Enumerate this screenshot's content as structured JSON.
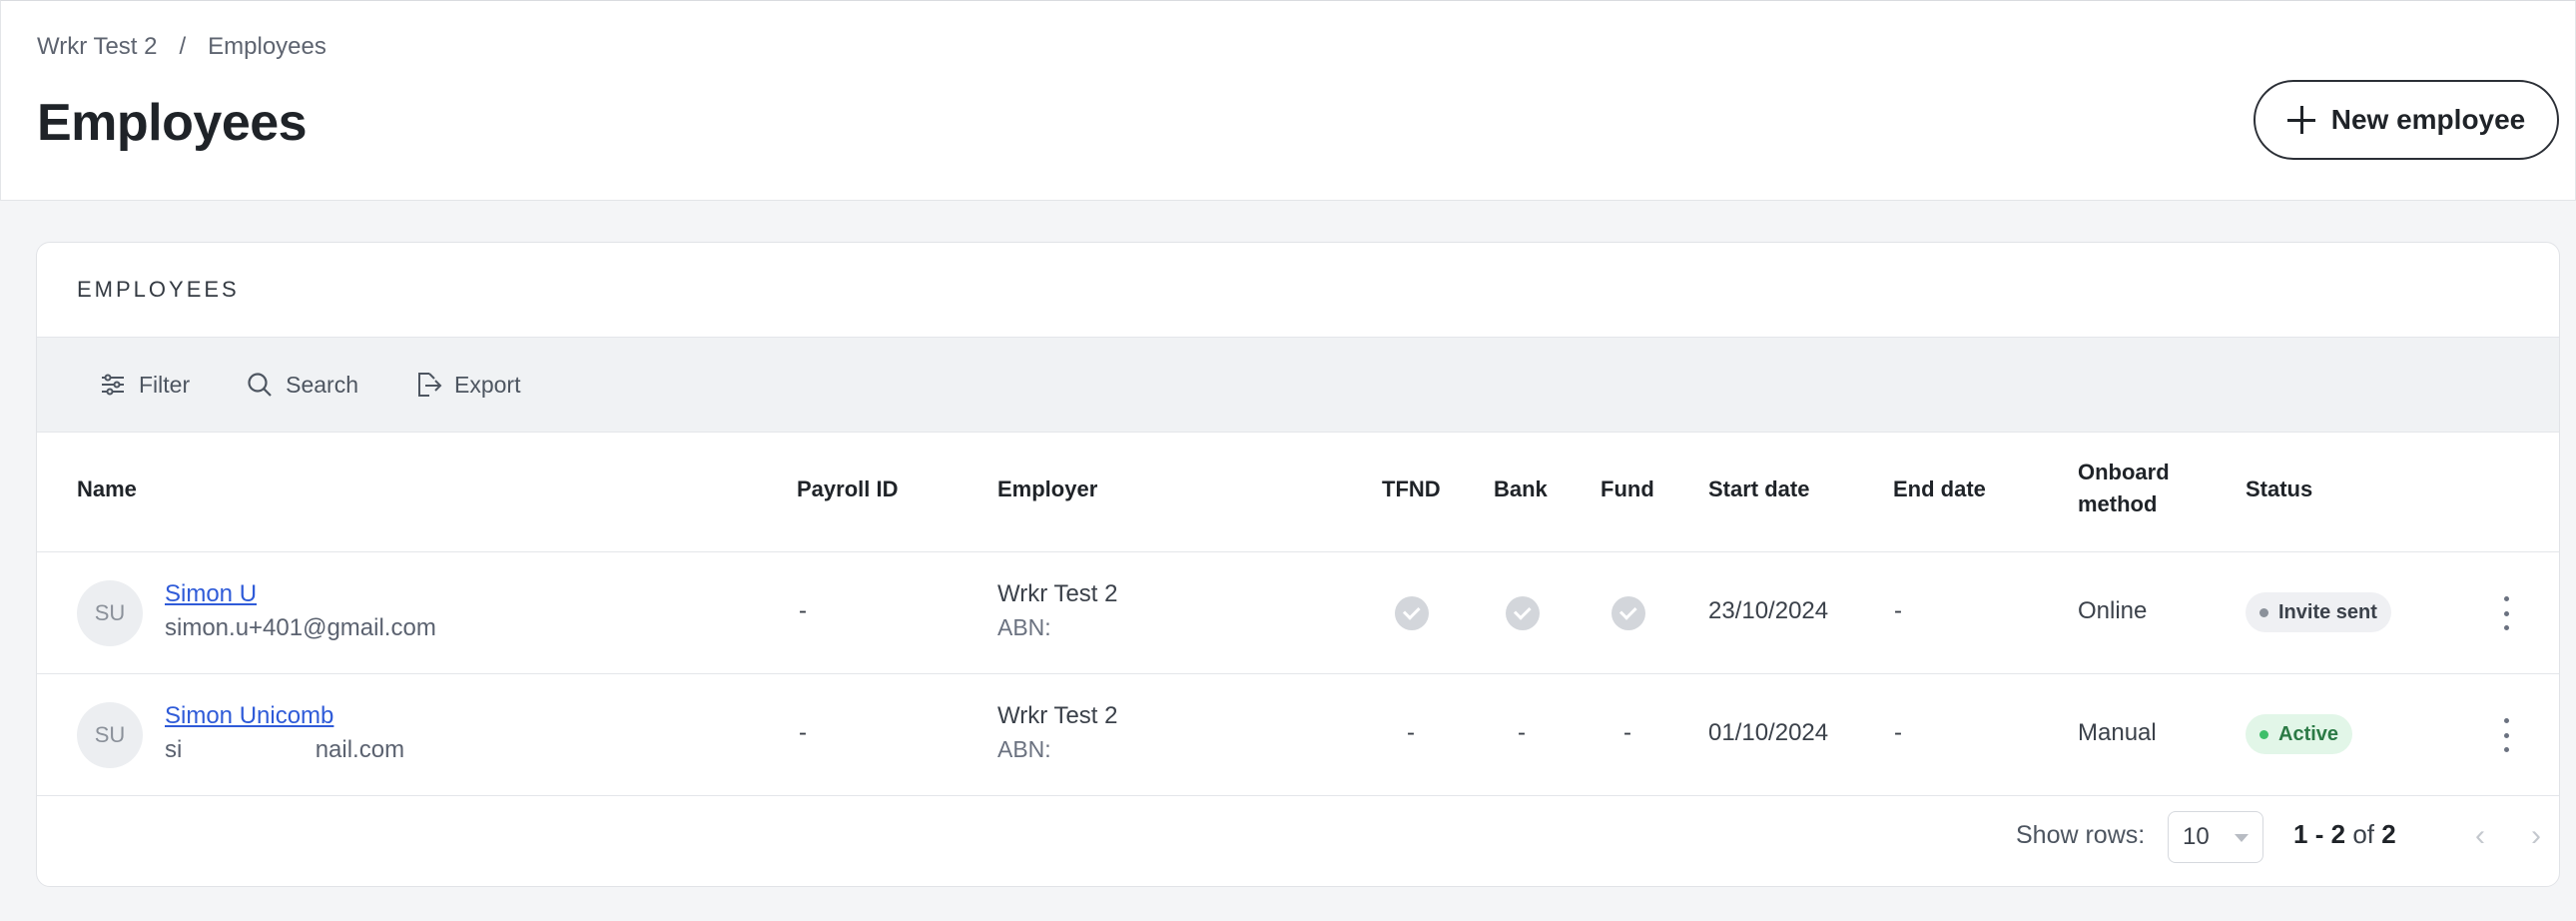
{
  "breadcrumb": {
    "parent": "Wrkr Test 2",
    "separator": "/",
    "current": "Employees"
  },
  "page_title": "Employees",
  "new_button_label": "New employee",
  "card_title": "EMPLOYEES",
  "toolbar": {
    "filter": "Filter",
    "search": "Search",
    "export": "Export"
  },
  "columns": {
    "name": "Name",
    "payroll_id": "Payroll ID",
    "employer": "Employer",
    "tfnd": "TFND",
    "bank": "Bank",
    "fund": "Fund",
    "start_date": "Start date",
    "end_date": "End date",
    "onboard_1": "Onboard",
    "onboard_2": "method",
    "status": "Status"
  },
  "rows": [
    {
      "initials": "SU",
      "name": "Simon U",
      "email": "simon.u+401@gmail.com",
      "payroll_id": "-",
      "employer": "Wrkr Test 2",
      "abn": "ABN:",
      "tfnd": "check",
      "bank": "check",
      "fund": "check",
      "start_date": "23/10/2024",
      "end_date": "-",
      "onboard": "Online",
      "status": "Invite sent"
    },
    {
      "initials": "SU",
      "name": "Simon Unicomb",
      "email": "si                    nail.com",
      "payroll_id": "-",
      "employer": "Wrkr Test 2",
      "abn": "ABN:",
      "tfnd": "-",
      "bank": "-",
      "fund": "-",
      "start_date": "01/10/2024",
      "end_date": "-",
      "onboard": "Manual",
      "status": "Active"
    }
  ],
  "footer": {
    "show_rows_label": "Show rows:",
    "rows_value": "10",
    "range_start": "1",
    "range_dash": "-",
    "range_end": "2",
    "of_label": "of",
    "total": "2"
  },
  "colors": {
    "link": "#2f5bd8",
    "active_bg": "#e2f6e8",
    "active_text": "#2b7a45",
    "invite_bg": "#eff0f3"
  }
}
